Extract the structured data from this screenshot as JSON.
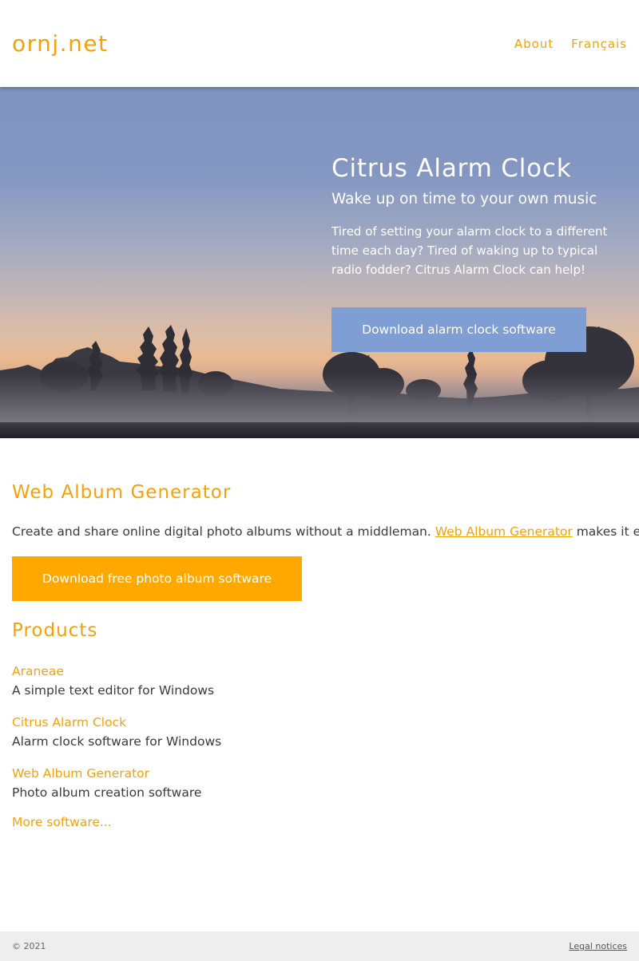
{
  "header": {
    "brand": "ornj.net",
    "nav": [
      {
        "label": "About"
      },
      {
        "label": "Français"
      }
    ]
  },
  "hero": {
    "title": "Citrus Alarm Clock",
    "subtitle": "Wake up on time to your own music",
    "description": "Tired of setting your alarm clock to a different time each day? Tired of waking up to typical radio fodder? Citrus Alarm Clock can help!",
    "button_label": "Download alarm clock software",
    "button_color": "#7f9ed3"
  },
  "web_album": {
    "title": "Web Album Generator",
    "desc_before": "Create and share online digital photo albums without a middleman. ",
    "desc_link": "Web Album Generator",
    "desc_after": " makes it easy!",
    "button_label": "Download free photo album software",
    "button_color": "#ffa800"
  },
  "products": {
    "title": "Products",
    "items": [
      {
        "name": "Araneae",
        "description": "A simple text editor for Windows"
      },
      {
        "name": "Citrus Alarm Clock",
        "description": "Alarm clock software for Windows"
      },
      {
        "name": "Web Album Generator",
        "description": "Photo album creation software"
      }
    ],
    "more_label": "More software..."
  },
  "footer": {
    "copyright": "© 2021",
    "legal_label": "Legal notices"
  },
  "colors": {
    "accent": "#f5a20a",
    "footer_bg": "#eeeeee"
  }
}
